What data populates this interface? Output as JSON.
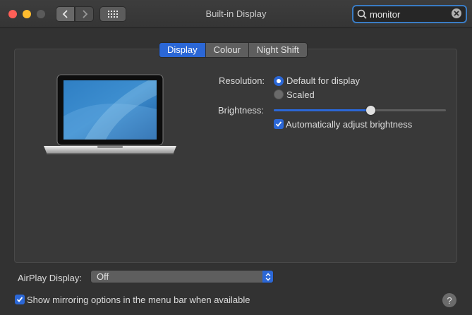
{
  "window": {
    "title": "Built-in Display"
  },
  "search": {
    "value": "monitor"
  },
  "tabs": [
    {
      "label": "Display",
      "active": true
    },
    {
      "label": "Colour",
      "active": false
    },
    {
      "label": "Night Shift",
      "active": false
    }
  ],
  "display": {
    "resolution_label": "Resolution:",
    "resolution_options": [
      {
        "label": "Default for display",
        "selected": true
      },
      {
        "label": "Scaled",
        "selected": false
      }
    ],
    "brightness_label": "Brightness:",
    "brightness_level": 0.56,
    "auto_brightness_label": "Automatically adjust brightness",
    "auto_brightness_checked": true
  },
  "airplay": {
    "label": "AirPlay Display:",
    "value": "Off"
  },
  "mirroring": {
    "label": "Show mirroring options in the menu bar when available",
    "checked": true
  },
  "help": {
    "label": "?"
  },
  "colors": {
    "accent": "#2b67d6",
    "search_focus": "#3a7cc4"
  }
}
